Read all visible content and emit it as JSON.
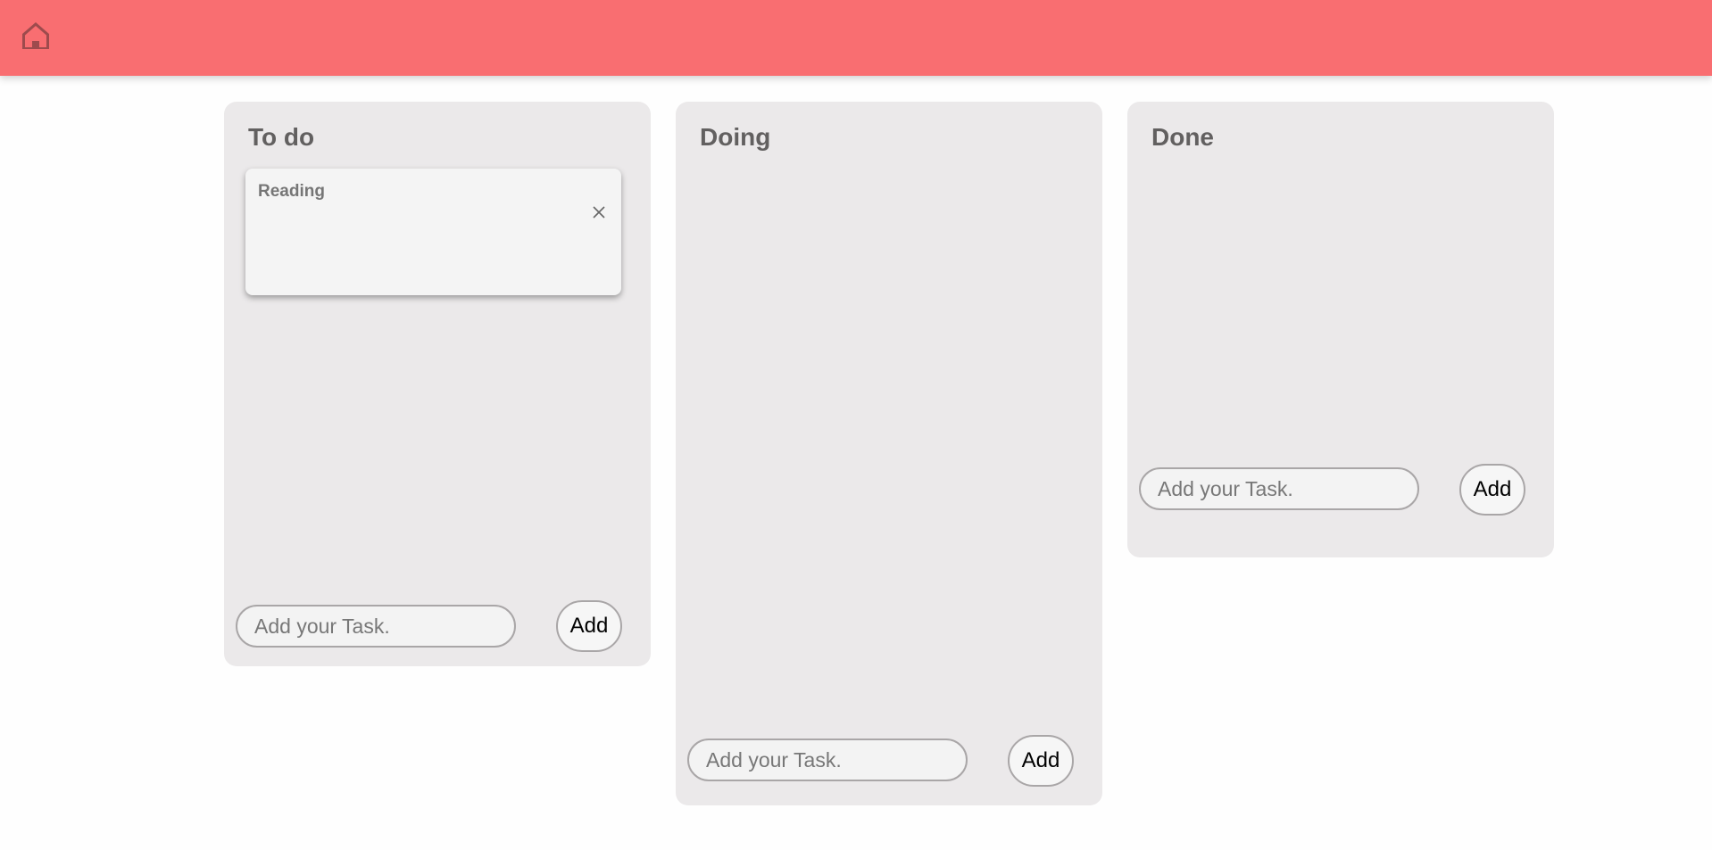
{
  "header": {
    "home_icon": "home-icon",
    "background_color": "#f96e71"
  },
  "board": {
    "columns": [
      {
        "title": "To do",
        "cards": [
          {
            "title": "Reading",
            "close_icon": "close-icon"
          }
        ],
        "input_placeholder": "Add your Task.",
        "add_label": "Add"
      },
      {
        "title": "Doing",
        "cards": [],
        "input_placeholder": "Add your Task.",
        "add_label": "Add"
      },
      {
        "title": "Done",
        "cards": [],
        "input_placeholder": "Add your Task.",
        "add_label": "Add"
      }
    ]
  },
  "colors": {
    "column_background": "#ebe9ea",
    "card_background": "#f4f4f4",
    "title_text": "#626060"
  }
}
